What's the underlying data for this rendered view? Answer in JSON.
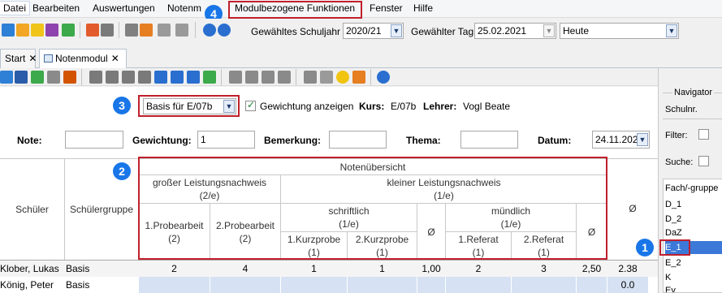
{
  "menu": [
    "Datei",
    "Bearbeiten",
    "Auswertungen",
    "Notenm",
    "Modulbezogene Funktionen",
    "Fenster",
    "Hilfe"
  ],
  "toolbar": {
    "schuljahr_label": "Gewähltes Schuljahr",
    "schuljahr_value": "2020/21",
    "tag_label": "Gewählter Tag",
    "tag_value": "25.02.2021",
    "tag_preset": "Heute"
  },
  "tabs": [
    {
      "label": "Start",
      "close": "✕"
    },
    {
      "label": "Notenmodul",
      "close": "✕"
    }
  ],
  "filter": {
    "select_value": "Basis für E/07b",
    "gewichtung_label": "Gewichtung anzeigen",
    "kurs_label": "Kurs:",
    "kurs_value": "E/07b",
    "lehrer_label": "Lehrer:",
    "lehrer_value": "Vogl Beate"
  },
  "entry": {
    "note_label": "Note:",
    "note_value": "",
    "gewichtung_label": "Gewichtung:",
    "gewichtung_value": "1",
    "bemerkung_label": "Bemerkung:",
    "bemerkung_value": "",
    "thema_label": "Thema:",
    "thema_value": "",
    "datum_label": "Datum:",
    "datum_value": "24.11.202"
  },
  "grid": {
    "schueler": "Schüler",
    "schuelergruppe": "Schülergruppe",
    "notenuebersicht": "Notenübersicht",
    "gross_line1": "großer Leistungsnachweis",
    "gross_line2": "(2/e)",
    "klein_line1": "kleiner Leistungsnachweis",
    "klein_line2": "(1/e)",
    "pa1_line1": "1.Probearbeit",
    "pa1_line2": "(2)",
    "pa2_line1": "2.Probearbeit",
    "pa2_line2": "(2)",
    "schriftlich_line1": "schriftlich",
    "schriftlich_line2": "(1/e)",
    "muendlich_line1": "mündlich",
    "muendlich_line2": "(1/e)",
    "kp1_line1": "1.Kurzprobe",
    "kp1_line2": "(1)",
    "kp2_line1": "2.Kurzprobe",
    "kp2_line2": "(1)",
    "ref1_line1": "1.Referat",
    "ref1_line2": "(1)",
    "ref2_line1": "2.Referat",
    "ref2_line2": "(1)",
    "avg": "Ø",
    "rows": [
      {
        "name": "Klober, Lukas",
        "gruppe": "Basis",
        "pa1": "2",
        "pa2": "4",
        "kp1": "1",
        "kp2": "1",
        "avg_s": "1,00",
        "ref1": "2",
        "ref2": "3",
        "avg_m": "2,50",
        "avg": "2.38"
      },
      {
        "name": "König, Peter",
        "gruppe": "Basis",
        "pa1": "",
        "pa2": "",
        "kp1": "",
        "kp2": "",
        "avg_s": "",
        "ref1": "",
        "ref2": "",
        "avg_m": "",
        "avg": "0.0"
      }
    ]
  },
  "navigator": {
    "title": "Navigator",
    "sort": "Schulnr.",
    "filter_label": "Filter:",
    "suche_label": "Suche:",
    "list_header": "Fach/-gruppe",
    "items": [
      "D_1",
      "D_2",
      "DaZ",
      "E_1",
      "E_2",
      "K",
      "Ev"
    ],
    "selected": "E_1"
  },
  "badges": [
    "1",
    "2",
    "3",
    "4"
  ],
  "colors": {
    "highlight": "#c0202c",
    "badge": "#1976e8",
    "selection": "#3b78d8"
  }
}
